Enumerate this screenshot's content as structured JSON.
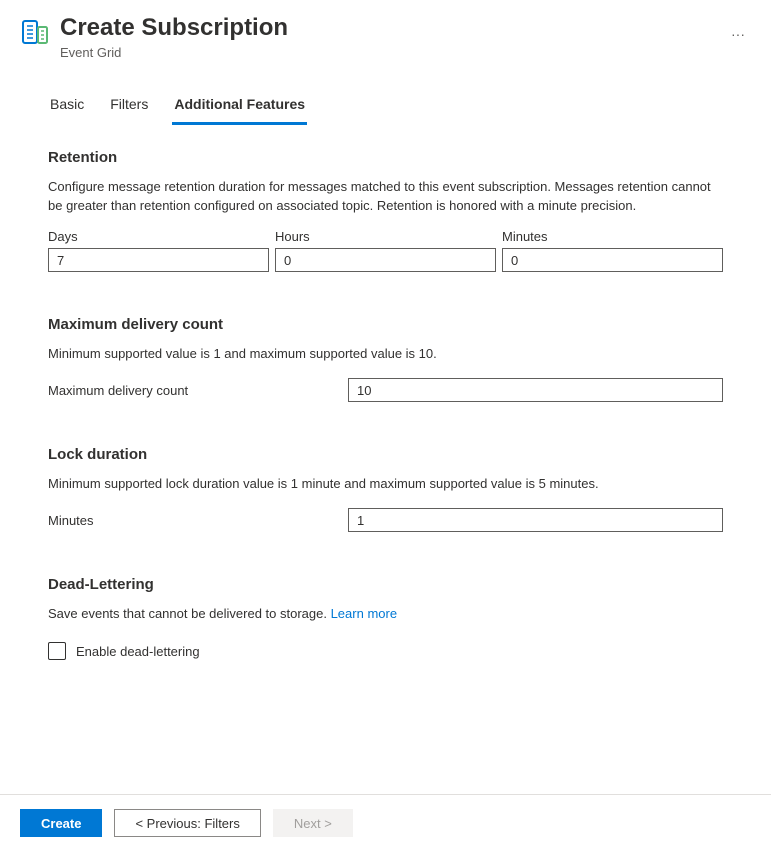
{
  "header": {
    "title": "Create Subscription",
    "subtitle": "Event Grid"
  },
  "tabs": {
    "basic": "Basic",
    "filters": "Filters",
    "additional": "Additional Features"
  },
  "retention": {
    "title": "Retention",
    "desc": "Configure message retention duration for messages matched to this event subscription. Messages retention cannot be greater than retention configured on associated topic. Retention is honored with a minute precision.",
    "days_label": "Days",
    "days_value": "7",
    "hours_label": "Hours",
    "hours_value": "0",
    "minutes_label": "Minutes",
    "minutes_value": "0"
  },
  "maxDelivery": {
    "title": "Maximum delivery count",
    "desc": "Minimum supported value is 1 and maximum supported value is 10.",
    "label": "Maximum delivery count",
    "value": "10"
  },
  "lockDuration": {
    "title": "Lock duration",
    "desc": "Minimum supported lock duration value is 1 minute and maximum supported value is 5 minutes.",
    "label": "Minutes",
    "value": "1"
  },
  "deadLettering": {
    "title": "Dead-Lettering",
    "desc": "Save events that cannot be delivered to storage. ",
    "learn_more": "Learn more",
    "checkbox_label": "Enable dead-lettering"
  },
  "footer": {
    "create": "Create",
    "previous": "< Previous: Filters",
    "next": "Next >"
  }
}
